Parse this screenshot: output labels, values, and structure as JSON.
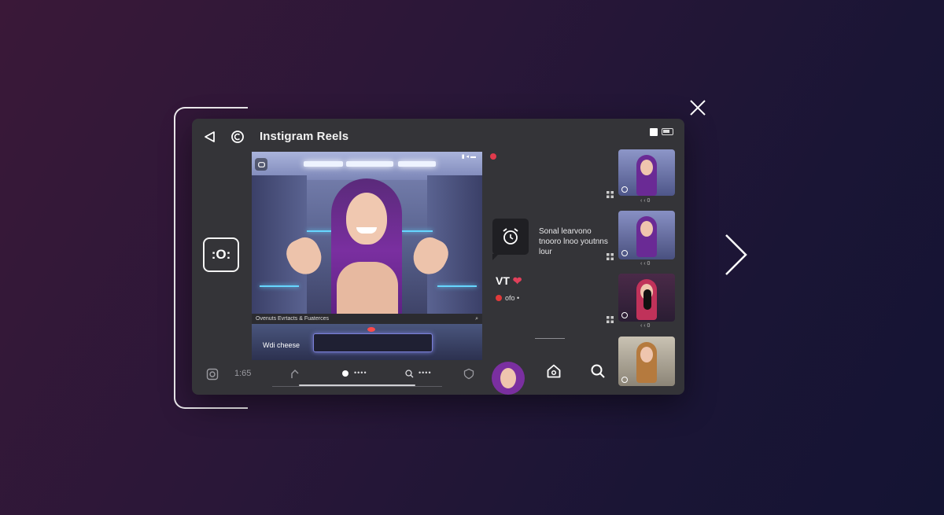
{
  "app": {
    "title": "Instigram Reels"
  },
  "colors": {
    "accent_record": "#e13a4c",
    "heart": "#e0405a",
    "panel_bg": "#343438"
  },
  "icons": {
    "back": "back-triangle-icon",
    "refresh": "refresh-icon",
    "close": "close-icon",
    "next": "chevron-right-icon",
    "home": "home-icon",
    "search": "search-icon",
    "chat": "alarm-chat-icon"
  },
  "left_button": {
    "label": ":O:"
  },
  "video": {
    "caption": "Ovenuts Evrtacts & Fuaterces",
    "caption_icon": "⌕",
    "status_icons": "▮ ◂ ▬",
    "overlay_label": "Wdi cheese"
  },
  "toolbar": {
    "time": "1:65",
    "dots_1": "••••",
    "dots_2": "••••"
  },
  "panel": {
    "chat_text": "Sonal learvono tnooro lnoo youtnns lour",
    "live_tag": "VT",
    "heart": "❤",
    "rec_label": "ofo •"
  },
  "thumbnails": [
    {
      "caption": "‹ ‹ 0"
    },
    {
      "caption": "‹ ‹ 0"
    },
    {
      "caption": "‹ ‹ 0"
    },
    {
      "caption": ""
    }
  ]
}
